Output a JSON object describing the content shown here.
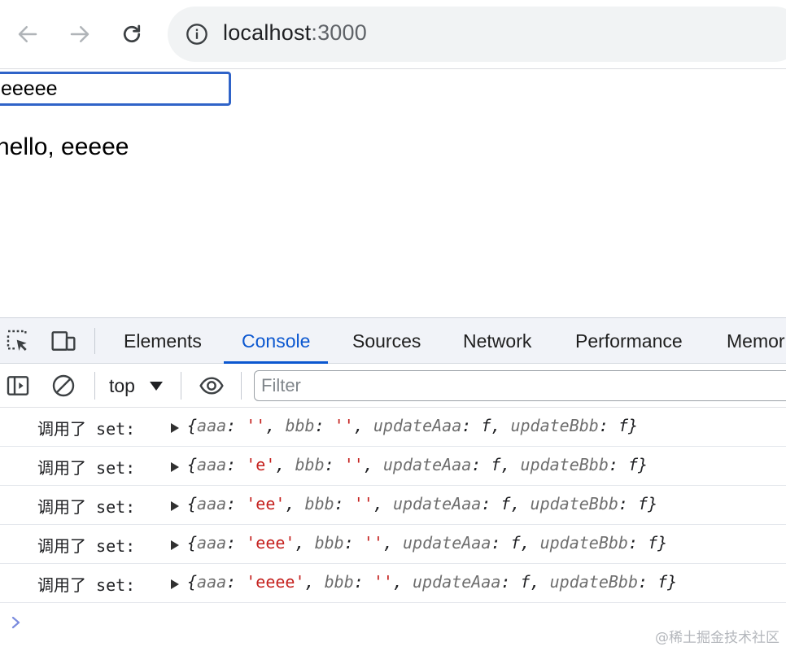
{
  "browser": {
    "url_host": "localhost",
    "url_port": ":3000",
    "icons": {
      "back": "arrow-left-icon",
      "forward": "arrow-right-icon",
      "reload": "reload-icon",
      "site_info": "info-icon"
    }
  },
  "page": {
    "input_value": "eeeee",
    "greeting": "hello, eeeee"
  },
  "devtools": {
    "tabs": [
      {
        "label": "Elements",
        "active": false
      },
      {
        "label": "Console",
        "active": true
      },
      {
        "label": "Sources",
        "active": false
      },
      {
        "label": "Network",
        "active": false
      },
      {
        "label": "Performance",
        "active": false
      },
      {
        "label": "Memor",
        "active": false
      }
    ],
    "context": "top",
    "filter_placeholder": "Filter",
    "accent_color": "#0b57d0",
    "console_messages": [
      {
        "prefix": "调用了 set:",
        "aaa": "''",
        "bbb": "''",
        "fn1": "updateAaa",
        "fn2": "updateBbb",
        "f": "f"
      },
      {
        "prefix": "调用了 set:",
        "aaa": "'e'",
        "bbb": "''",
        "fn1": "updateAaa",
        "fn2": "updateBbb",
        "f": "f"
      },
      {
        "prefix": "调用了 set:",
        "aaa": "'ee'",
        "bbb": "''",
        "fn1": "updateAaa",
        "fn2": "updateBbb",
        "f": "f"
      },
      {
        "prefix": "调用了 set:",
        "aaa": "'eee'",
        "bbb": "''",
        "fn1": "updateAaa",
        "fn2": "updateBbb",
        "f": "f"
      },
      {
        "prefix": "调用了 set:",
        "aaa": "'eeee'",
        "bbb": "''",
        "fn1": "updateAaa",
        "fn2": "updateBbb",
        "f": "f"
      }
    ],
    "keys": {
      "aaa": "aaa",
      "bbb": "bbb"
    }
  },
  "watermark": "@稀土掘金技术社区"
}
